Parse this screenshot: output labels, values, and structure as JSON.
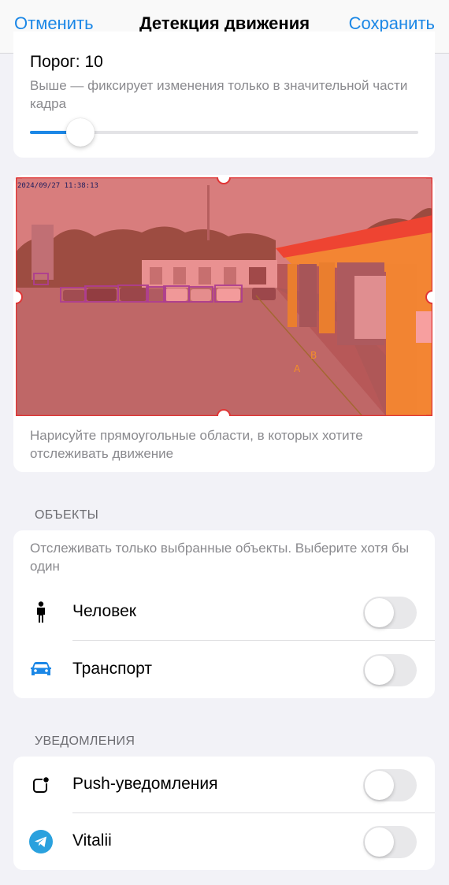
{
  "nav": {
    "cancel_label": "Отменить",
    "title": "Детекция движения",
    "save_label": "Сохранить"
  },
  "threshold": {
    "label": "Порог: 10",
    "value": 10,
    "slider_fraction": 0.13,
    "description": "Выше — фиксирует изменения только в значительной части кадра"
  },
  "camera": {
    "timestamp": "2024/09/27 11:38:13",
    "hint": "Нарисуйте прямоугольные области, в которых хотите отслеживать движение"
  },
  "objects": {
    "header": "ОБЪЕКТЫ",
    "description": "Отслеживать только выбранные объекты. Выберите хотя бы один",
    "items": [
      {
        "icon": "person-icon",
        "label": "Человек",
        "enabled": false
      },
      {
        "icon": "car-icon",
        "label": "Транспорт",
        "enabled": false
      }
    ]
  },
  "notifications": {
    "header": "УВЕДОМЛЕНИЯ",
    "items": [
      {
        "icon": "push-notification-icon",
        "label": "Push-уведомления",
        "enabled": false
      },
      {
        "icon": "telegram-icon",
        "label": "Vitalii",
        "enabled": false
      }
    ]
  },
  "colors": {
    "accent": "#1b87e6",
    "zone_overlay": "#ff3b3b",
    "toggle_off": "#e8e8ea"
  }
}
